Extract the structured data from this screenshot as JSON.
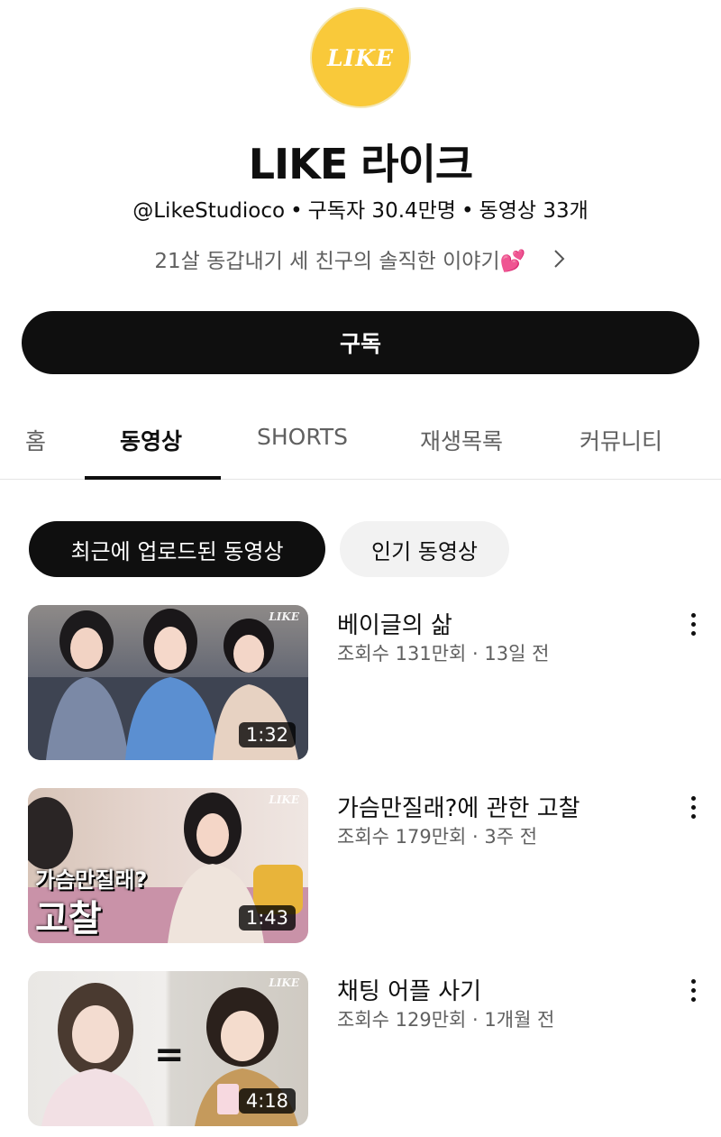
{
  "channel": {
    "avatar_text": "LIKE",
    "name": "LIKE 라이크",
    "handle": "@LikeStudioco",
    "subscribers": "구독자 30.4만명",
    "video_count": "동영상 33개",
    "separator": "•",
    "description": "21살 동갑내기 세 친구의 솔직한 이야기",
    "description_emoji": "💕"
  },
  "subscribe_label": "구독",
  "tabs": [
    {
      "label": "홈"
    },
    {
      "label": "동영상",
      "active": true
    },
    {
      "label": "SHORTS"
    },
    {
      "label": "재생목록"
    },
    {
      "label": "커뮤니티"
    }
  ],
  "filters": [
    {
      "label": "최근에 업로드된 동영상",
      "selected": true
    },
    {
      "label": "인기 동영상",
      "selected": false
    }
  ],
  "videos": [
    {
      "title": "베이글의 삶",
      "stats": "조회수 131만회 · 13일 전",
      "duration": "1:32",
      "logo": "LIKE"
    },
    {
      "title": "가슴만질래?에 관한 고찰",
      "stats": "조회수 179만회 · 3주 전",
      "duration": "1:43",
      "logo": "LIKE",
      "overlay_line1": "가슴만질래?",
      "overlay_line2": "고찰"
    },
    {
      "title": "채팅 어플 사기",
      "stats": "조회수 129만회 · 1개월 전",
      "duration": "4:18",
      "logo": "LIKE",
      "overlay_eq": "="
    }
  ],
  "icons": {
    "more": "more-vert-icon",
    "chevron": "chevron-right-icon"
  }
}
